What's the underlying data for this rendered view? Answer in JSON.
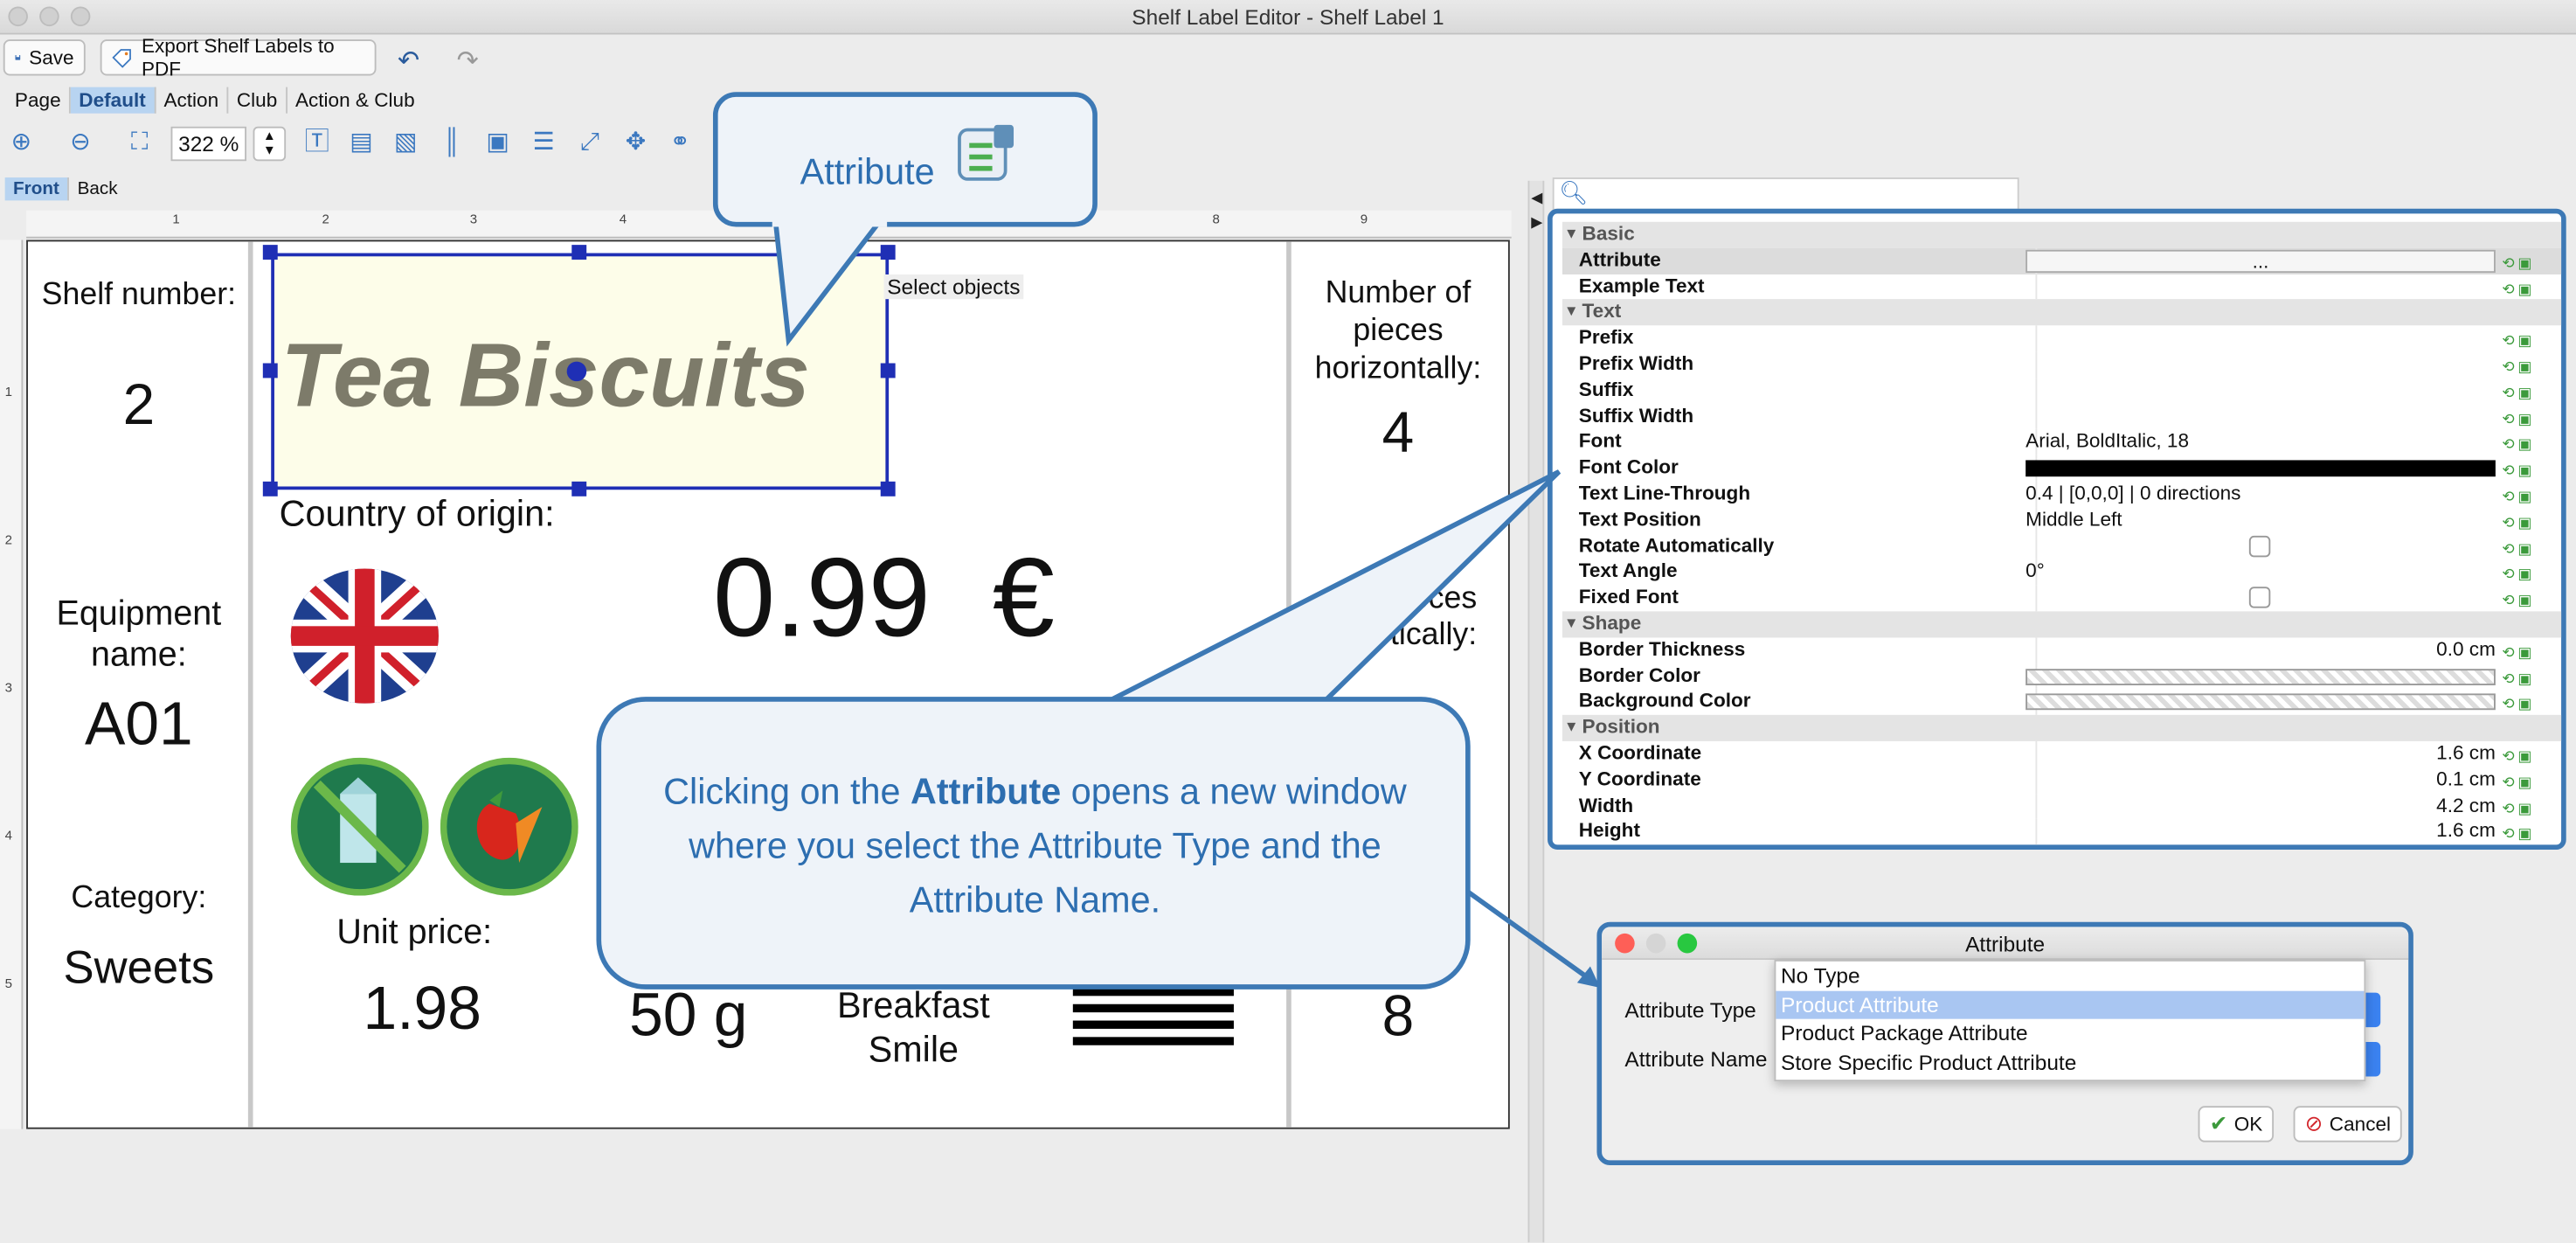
{
  "window": {
    "title": "Shelf Label Editor - Shelf Label 1"
  },
  "toolbar": {
    "save": "Save",
    "export": "Export Shelf Labels to PDF",
    "zoom": "322 %"
  },
  "tabs": [
    "Page",
    "Default",
    "Action",
    "Club",
    "Action & Club"
  ],
  "sides": [
    "Front",
    "Back"
  ],
  "ruler_top": [
    "1",
    "2",
    "3",
    "4",
    "8",
    "9"
  ],
  "ruler_left": [
    "1",
    "2",
    "3",
    "4",
    "5"
  ],
  "label": {
    "shelf_number_label": "Shelf number:",
    "shelf_number": "2",
    "equipment_label": "Equipment name:",
    "equipment": "A01",
    "category_label": "Category:",
    "category": "Sweets",
    "product_name": "Tea Biscuits",
    "select_objects": "Select objects",
    "country_label": "Country of origin:",
    "price": "0.99  €",
    "unit_price_label": "Unit price:",
    "unit_price": "1.98",
    "weight": "50 g",
    "brand": "Breakfast Smile",
    "pieces_h_label": "Number of pieces horizontally:",
    "pieces_h": "4",
    "pieces_v_label": "er of eces ertically:",
    "pieces_v": "8"
  },
  "callout_top": {
    "text": "Attribute"
  },
  "callout_main": {
    "pre": "Clicking on the ",
    "bold": "Attribute",
    "post": " opens a new window where you select the Attribute Type and the Attribute Name."
  },
  "properties": [
    {
      "type": "group",
      "name": "Basic"
    },
    {
      "name": "Attribute",
      "value": "...",
      "style": "button",
      "selected": true
    },
    {
      "name": "Example Text",
      "value": ""
    },
    {
      "type": "group",
      "name": "Text"
    },
    {
      "name": "Prefix",
      "value": ""
    },
    {
      "name": "Prefix Width",
      "value": ""
    },
    {
      "name": "Suffix",
      "value": ""
    },
    {
      "name": "Suffix Width",
      "value": ""
    },
    {
      "name": "Font",
      "value": "Arial, BoldItalic, 18"
    },
    {
      "name": "Font Color",
      "value": "",
      "style": "black"
    },
    {
      "name": "Text Line-Through",
      "value": "0.4 | [0,0,0] | 0 directions"
    },
    {
      "name": "Text Position",
      "value": "Middle Left"
    },
    {
      "name": "Rotate Automatically",
      "value": "",
      "style": "checkbox"
    },
    {
      "name": "Text Angle",
      "value": "0°"
    },
    {
      "name": "Fixed Font",
      "value": "",
      "style": "checkbox"
    },
    {
      "type": "group",
      "name": "Shape"
    },
    {
      "name": "Border Thickness",
      "value": "0.0 cm",
      "style": "right"
    },
    {
      "name": "Border Color",
      "value": "",
      "style": "transparent"
    },
    {
      "name": "Background Color",
      "value": "",
      "style": "transparent"
    },
    {
      "type": "group",
      "name": "Position"
    },
    {
      "name": "X Coordinate",
      "value": "1.6 cm",
      "style": "right"
    },
    {
      "name": "Y Coordinate",
      "value": "0.1 cm",
      "style": "right"
    },
    {
      "name": "Width",
      "value": "4.2 cm",
      "style": "right"
    },
    {
      "name": "Height",
      "value": "1.6 cm",
      "style": "right"
    }
  ],
  "dialog": {
    "title": "Attribute",
    "type_label": "Attribute Type",
    "name_label": "Attribute Name",
    "options": [
      "No Type",
      "Product Attribute",
      "Product Package Attribute",
      "Store Specific Product Attribute"
    ],
    "selected": 1,
    "ok": "OK",
    "cancel": "Cancel"
  },
  "colors": {
    "accent": "#3d79b5",
    "callout_text": "#2d6eb0",
    "selection": "#1f2fb5"
  }
}
